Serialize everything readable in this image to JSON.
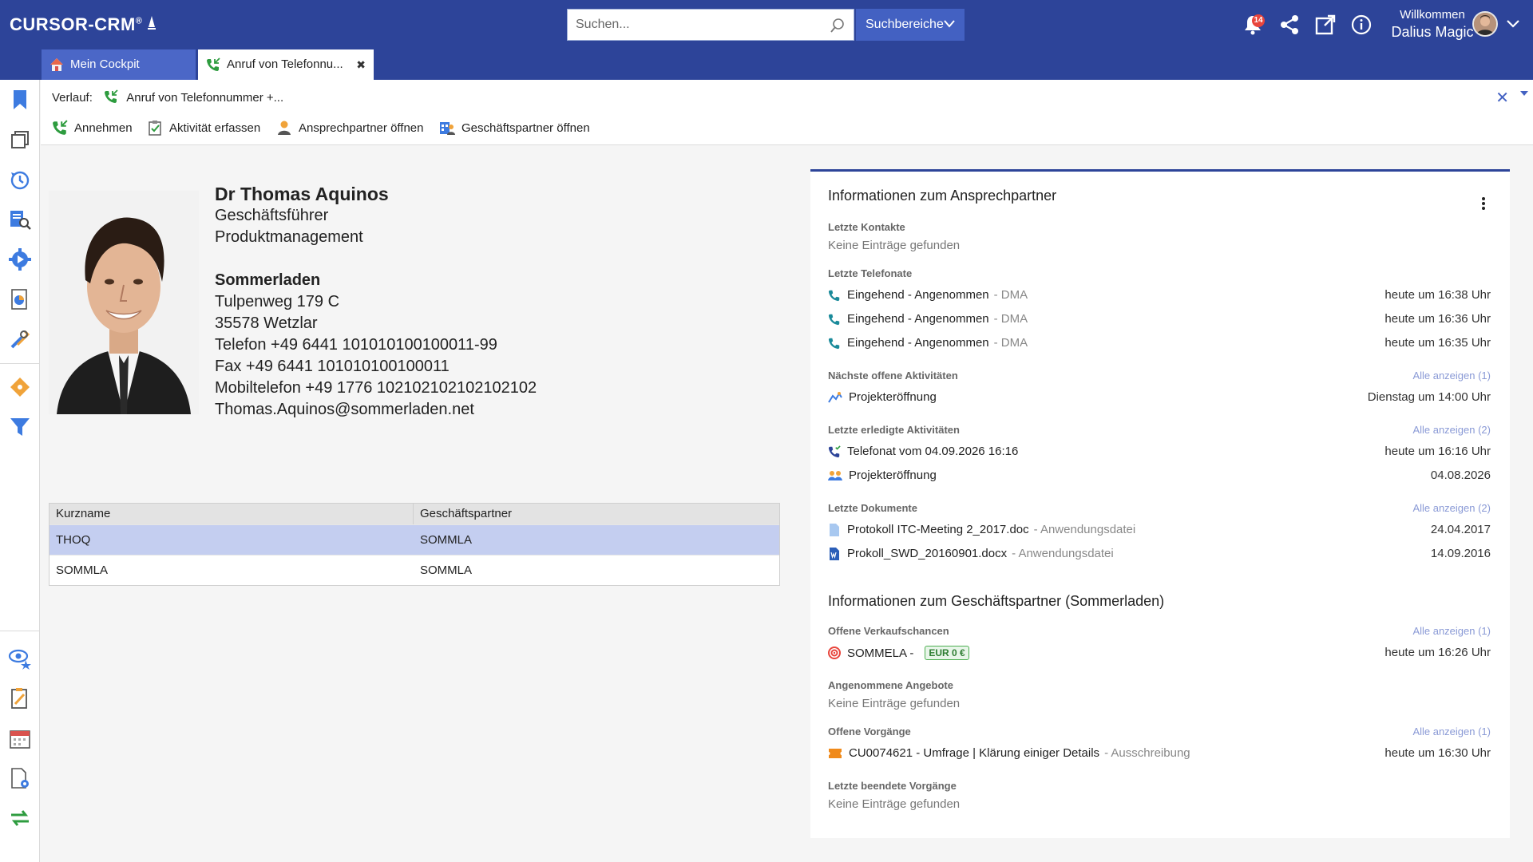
{
  "header": {
    "logo": "CURSOR-CRM",
    "search_placeholder": "Suchen...",
    "search_scope": "Suchbereiche",
    "notifications_count": "14",
    "welcome": "Willkommen",
    "user_name": "Dalius Magic"
  },
  "tabs": [
    {
      "label": "Mein Cockpit"
    },
    {
      "label": "Anruf von Telefonnu...",
      "close": "✖"
    }
  ],
  "history": {
    "label": "Verlauf:",
    "value": "Anruf von Telefonnummer +..."
  },
  "toolbar": {
    "accept": "Annehmen",
    "capture_activity": "Aktivität erfassen",
    "open_contact": "Ansprechpartner öffnen",
    "open_partner": "Geschäftspartner öffnen"
  },
  "contact": {
    "name": "Dr Thomas Aquinos",
    "position": "Geschäftsführer",
    "department": "Produktmanagement",
    "company": "Sommerladen",
    "street": "Tulpenweg 179 C",
    "city": "35578 Wetzlar",
    "phone": "Telefon +49 6441 101010100100011-99",
    "fax": "Fax +49 6441 101010100100011",
    "mobile": "Mobiltelefon +49 1776 102102102102102102",
    "email": "Thomas.Aquinos@sommerladen.net"
  },
  "table": {
    "headers": [
      "Kurzname",
      "Geschäftspartner"
    ],
    "rows": [
      [
        "THOQ",
        "SOMMLA"
      ],
      [
        "SOMMLA",
        "SOMMLA"
      ]
    ]
  },
  "info": {
    "title_contact": "Informationen zum Ansprechpartner",
    "last_contacts": {
      "title": "Letzte Kontakte",
      "empty": "Keine Einträge gefunden"
    },
    "last_calls": {
      "title": "Letzte Telefonate",
      "items": [
        {
          "text": "Eingehend - Angenommen",
          "sub": "- DMA",
          "date": "heute um 16:38 Uhr"
        },
        {
          "text": "Eingehend - Angenommen",
          "sub": "- DMA",
          "date": "heute um 16:36 Uhr"
        },
        {
          "text": "Eingehend - Angenommen",
          "sub": "- DMA",
          "date": "heute um 16:35 Uhr"
        }
      ]
    },
    "next_open": {
      "title": "Nächste offene Aktivitäten",
      "more": "Alle anzeigen (1)",
      "items": [
        {
          "text": "Projekteröffnung",
          "date": "Dienstag um 14:00 Uhr"
        }
      ]
    },
    "last_done": {
      "title": "Letzte erledigte Aktivitäten",
      "more": "Alle anzeigen (2)",
      "items": [
        {
          "text": "Telefonat vom 04.09.2026 16:16",
          "date": "heute um 16:16 Uhr"
        },
        {
          "text": "Projekteröffnung",
          "date": "04.08.2026"
        }
      ]
    },
    "last_docs": {
      "title": "Letzte Dokumente",
      "more": "Alle anzeigen (2)",
      "items": [
        {
          "text": "Protokoll ITC-Meeting 2_2017.doc",
          "sub": "- Anwendungsdatei",
          "date": "24.04.2017"
        },
        {
          "text": "Prokoll_SWD_20160901.docx",
          "sub": "- Anwendungsdatei",
          "date": "14.09.2016"
        }
      ]
    },
    "title_partner": "Informationen zum Geschäftspartner (Sommerladen)",
    "open_opps": {
      "title": "Offene Verkaufschancen",
      "more": "Alle anzeigen (1)",
      "items": [
        {
          "text": "SOMMELA -",
          "badge": "EUR 0 €",
          "date": "heute um 16:26 Uhr"
        }
      ]
    },
    "accepted_offers": {
      "title": "Angenommene Angebote",
      "empty": "Keine Einträge gefunden"
    },
    "open_procs": {
      "title": "Offene Vorgänge",
      "more": "Alle anzeigen (1)",
      "items": [
        {
          "text": "CU0074621 - Umfrage | Klärung einiger Details",
          "sub": "- Ausschreibung",
          "date": "heute um 16:30 Uhr"
        }
      ]
    },
    "closed_procs": {
      "title": "Letzte beendete Vorgänge",
      "empty": "Keine Einträge gefunden"
    }
  },
  "colors": {
    "header": "#2d4499",
    "accent": "#4361c2",
    "selected_row": "#c4cef0"
  }
}
